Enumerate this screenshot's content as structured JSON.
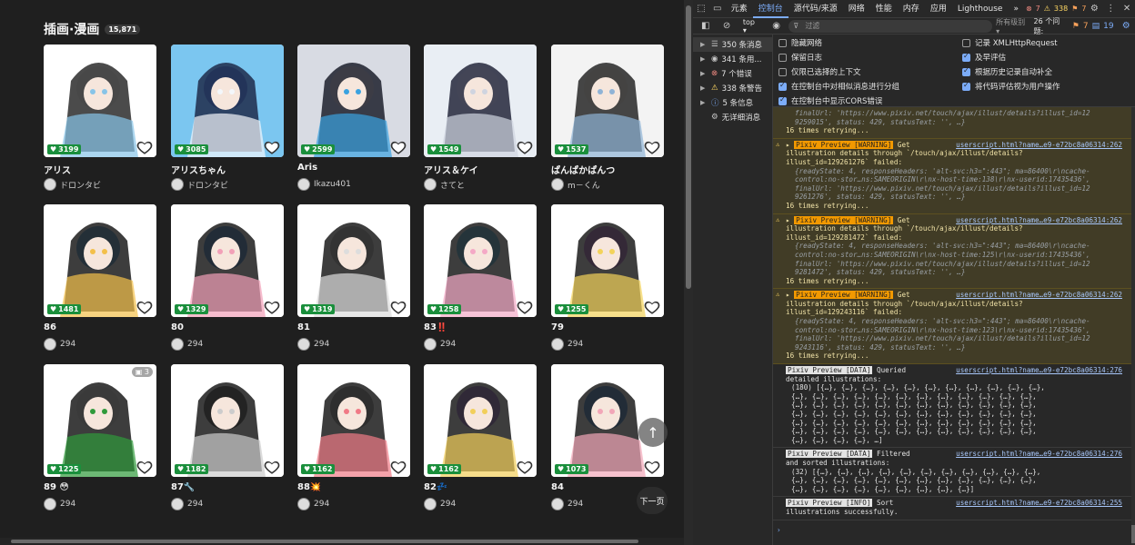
{
  "section": {
    "title": "插画·漫画",
    "count": "15,871"
  },
  "cards": [
    {
      "likes": "3199",
      "title": "アリス",
      "author": "ドロンタビ",
      "pages": "",
      "palette": [
        "#ffffff",
        "#2b2b2b",
        "#87c4e8",
        "#e9e9e9"
      ]
    },
    {
      "likes": "3085",
      "title": "アリスちゃん",
      "author": "ドロンタビ",
      "pages": "",
      "palette": [
        "#7bc6f0",
        "#1e2a4a",
        "#f3f7fb",
        "#3d6fb0"
      ]
    },
    {
      "likes": "2599",
      "title": "Aris",
      "author": "Ikazu401",
      "pages": "",
      "palette": [
        "#d8dbe3",
        "#1c1f2b",
        "#3aa2e0",
        "#f0e2d6"
      ]
    },
    {
      "likes": "1549",
      "title": "アリス＆ケイ",
      "author": "さてと",
      "pages": "",
      "palette": [
        "#e9eef4",
        "#23263a",
        "#cfd4e0",
        "#f5f5f5"
      ]
    },
    {
      "likes": "1537",
      "title": "ぱんぱかぱんつ",
      "author": "m－くん",
      "pages": "",
      "palette": [
        "#f3f3f3",
        "#262626",
        "#8fb3d6",
        "#efe6e2"
      ]
    },
    {
      "likes": "1481",
      "title": "86",
      "author": "294",
      "pages": "",
      "palette": [
        "#ffffff",
        "#1b1b1b",
        "#f3c04a",
        "#5aa0d8"
      ]
    },
    {
      "likes": "1329",
      "title": "80",
      "author": "294",
      "pages": "",
      "palette": [
        "#ffffff",
        "#1b1b1b",
        "#f2a0b8",
        "#4d8ed8"
      ]
    },
    {
      "likes": "1319",
      "title": "81",
      "author": "294",
      "pages": "",
      "palette": [
        "#ffffff",
        "#1b1b1b",
        "#dddddd",
        "#bbbbbb"
      ]
    },
    {
      "likes": "1258",
      "title": "83‼️",
      "author": "294",
      "pages": "",
      "palette": [
        "#ffffff",
        "#1b1b1b",
        "#f4a9c6",
        "#62c1e8"
      ]
    },
    {
      "likes": "1255",
      "title": "79",
      "author": "294",
      "pages": "",
      "palette": [
        "#ffffff",
        "#1b1b1b",
        "#f3d35a",
        "#c07ad8"
      ]
    },
    {
      "likes": "1225",
      "title": "89 😳",
      "author": "294",
      "pages": "3",
      "palette": [
        "#ffffff",
        "#1b1b1b",
        "#2f9a3b",
        "#e6e6e6"
      ]
    },
    {
      "likes": "1182",
      "title": "87🔧",
      "author": "294",
      "pages": "",
      "palette": [
        "#ffffff",
        "#1b1b1b",
        "#cccccc",
        "#555555"
      ]
    },
    {
      "likes": "1162",
      "title": "88💥",
      "author": "294",
      "pages": "",
      "palette": [
        "#ffffff",
        "#1b1b1b",
        "#f07a86",
        "#999999"
      ]
    },
    {
      "likes": "1162",
      "title": "82💤",
      "author": "294",
      "pages": "",
      "palette": [
        "#ffffff",
        "#1b1b1b",
        "#f2cf5a",
        "#a97ad8"
      ]
    },
    {
      "likes": "1073",
      "title": "84",
      "author": "294",
      "pages": "",
      "palette": [
        "#ffffff",
        "#1b1b1b",
        "#f2a6b8",
        "#4a8fd8"
      ]
    }
  ],
  "controls": {
    "scroll_up": "↑",
    "next_page": "下一页"
  },
  "devtools": {
    "tabs": [
      "元素",
      "源代码/来源",
      "网络",
      "性能",
      "内存",
      "应用",
      "Lighthouse"
    ],
    "active_tab": "控制台",
    "more": "»",
    "badge_errors": "7",
    "badge_warnings": "338",
    "badge_info": "7",
    "context": "top ▾",
    "filter_placeholder": "过滤",
    "levels": "所有级别 ▾",
    "issues_label": "26 个问题:",
    "issues_info": "7",
    "issues_other": "19",
    "sidebar": [
      {
        "label": "350 条消息",
        "icon": "list-icon"
      },
      {
        "label": "341 条用...",
        "icon": "user-icon"
      },
      {
        "label": "7 个错误",
        "icon": "error-icon"
      },
      {
        "label": "338 条警告",
        "icon": "warning-icon"
      },
      {
        "label": "5 条信息",
        "icon": "info-icon"
      },
      {
        "label": "无详细消息",
        "icon": "gear-icon"
      }
    ],
    "settings_left": [
      {
        "label": "隐藏网络",
        "checked": false
      },
      {
        "label": "保留日志",
        "checked": false
      },
      {
        "label": "仅限已选择的上下文",
        "checked": false
      },
      {
        "label": "在控制台中对相似消息进行分组",
        "checked": true
      },
      {
        "label": "在控制台中显示CORS错误",
        "checked": true
      }
    ],
    "settings_right": [
      {
        "label": "记录 XMLHttpRequest",
        "checked": false
      },
      {
        "label": "及早评估",
        "checked": true
      },
      {
        "label": "根据历史记录自动补全",
        "checked": true
      },
      {
        "label": "将代码评估视为用户操作",
        "checked": true
      }
    ],
    "log_top": [
      "finalUrl: 'https://www.pixiv.net/touch/ajax/illust/details?illust_id=12",
      "9259015', status: 429, statusText: '', …}",
      "16 times retrying..."
    ],
    "warnings": [
      {
        "tag": "Pixiv Preview [WARNING]",
        "source": "userscript.html?name…e9-e72bc8a06314:262",
        "l1": "Get",
        "l2": "illustration details through `/touch/ajax/illust/details?",
        "l3": "illust_id=129261276` failed:",
        "o1": "{readyState: 4, responseHeaders: 'alt-svc:h3=\":443\"; ma=86400\\r\\ncache-",
        "o2": "control:no-stor…ns:SAMEORIGIN\\r\\nx-host-time:138\\r\\nx-userid:17435436',",
        "o3": "finalUrl: 'https://www.pixiv.net/touch/ajax/illust/details?illust_id=12",
        "o4": "9261276', status: 429, statusText: '', …}",
        "retry": "16 times retrying..."
      },
      {
        "tag": "Pixiv Preview [WARNING]",
        "source": "userscript.html?name…e9-e72bc8a06314:262",
        "l1": "Get",
        "l2": "illustration details through `/touch/ajax/illust/details?",
        "l3": "illust_id=129281472` failed:",
        "o1": "{readyState: 4, responseHeaders: 'alt-svc:h3=\":443\"; ma=86400\\r\\ncache-",
        "o2": "control:no-stor…ns:SAMEORIGIN\\r\\nx-host-time:125\\r\\nx-userid:17435436',",
        "o3": "finalUrl: 'https://www.pixiv.net/touch/ajax/illust/details?illust_id=12",
        "o4": "9281472', status: 429, statusText: '', …}",
        "retry": "16 times retrying..."
      },
      {
        "tag": "Pixiv Preview [WARNING]",
        "source": "userscript.html?name…e9-e72bc8a06314:262",
        "l1": "Get",
        "l2": "illustration details through `/touch/ajax/illust/details?",
        "l3": "illust_id=129243116` failed:",
        "o1": "{readyState: 4, responseHeaders: 'alt-svc:h3=\":443\"; ma=86400\\r\\ncache-",
        "o2": "control:no-stor…ns:SAMEORIGIN\\r\\nx-host-time:123\\r\\nx-userid:17435436',",
        "o3": "finalUrl: 'https://www.pixiv.net/touch/ajax/illust/details?illust_id=12",
        "o4": "9243116', status: 429, statusText: '', …}",
        "retry": "16 times retrying..."
      }
    ],
    "data1": {
      "tag": "Pixiv Preview [DATA]",
      "text": "Queried",
      "source": "userscript.html?name…e9-e72bc8a06314:276",
      "l2": "detailed illustrations:",
      "arr": "(180) [{…}, {…}, {…}, {…}, {…}, {…}, {…}, {…}, {…}, {…}, {…},",
      "arr2": "{…}, {…}, {…}, {…}, {…}, {…}, {…}, {…}, {…}, {…}, {…}, {…},",
      "arr_end": "{…}, {…}, {…}, {…}, …]"
    },
    "data2": {
      "tag": "Pixiv Preview [DATA]",
      "text": "Filtered",
      "source": "userscript.html?name…e9-e72bc8a06314:276",
      "l2": "and sorted illustrations:",
      "arr": "(32) [{…}, {…}, {…}, {…}, {…}, {…}, {…}, {…}, {…}, {…}, {…},",
      "arr2": "{…}, {…}, {…}, {…}, {…}, {…}, {…}, {…}, {…}, {…}, {…}, {…},",
      "arr_end": "{…}, {…}, {…}, {…}, {…}, {…}, {…}, {…}, {…}]"
    },
    "info": {
      "tag": "Pixiv Preview [INFO]",
      "text": "Sort",
      "source": "userscript.html?name…e9-e72bc8a06314:255",
      "l2": "illustrations successfully."
    },
    "prompt": "›"
  }
}
